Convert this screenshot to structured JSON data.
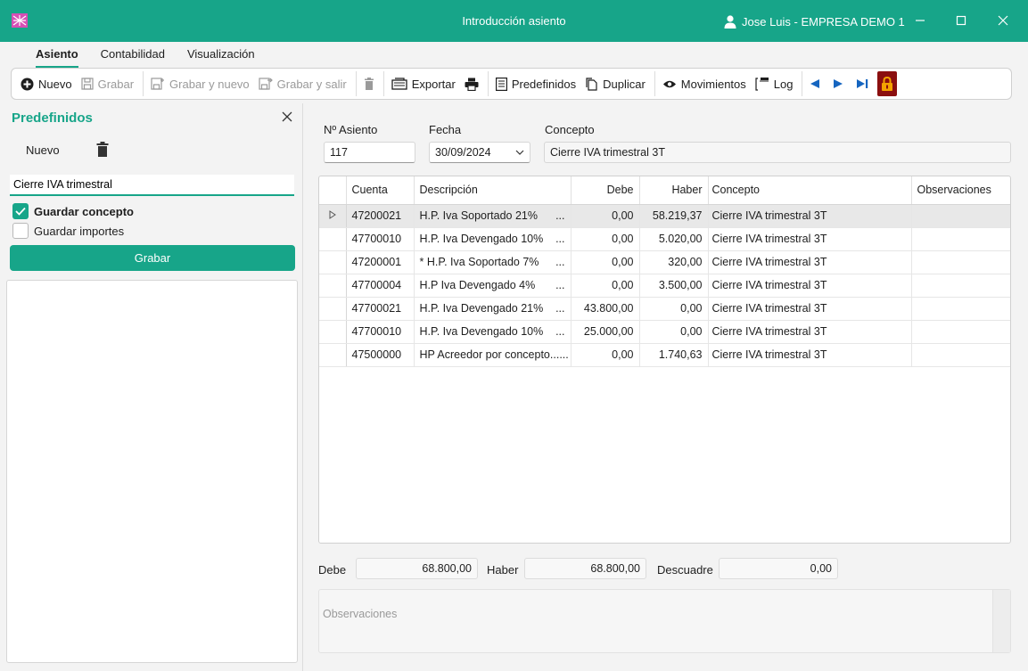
{
  "window": {
    "title": "Introducción asiento",
    "user": "Jose Luis - EMPRESA DEMO 1"
  },
  "ribbon": {
    "tabs": [
      {
        "label": "Asiento",
        "active": true
      },
      {
        "label": "Contabilidad",
        "active": false
      },
      {
        "label": "Visualización",
        "active": false
      }
    ]
  },
  "toolbar": {
    "nuevo": "Nuevo",
    "grabar": "Grabar",
    "grabar_nuevo": "Grabar y nuevo",
    "grabar_salir": "Grabar y salir",
    "exportar": "Exportar",
    "predefinidos": "Predefinidos",
    "duplicar": "Duplicar",
    "movimientos": "Movimientos",
    "log": "Log"
  },
  "left_panel": {
    "title": "Predefinidos",
    "nuevo": "Nuevo",
    "input_value": "Cierre IVA trimestral",
    "guardar_concepto": "Guardar concepto",
    "guardar_concepto_checked": true,
    "guardar_importes": "Guardar importes",
    "guardar_importes_checked": false,
    "grabar": "Grabar"
  },
  "header": {
    "asiento_label": "Nº Asiento",
    "asiento_value": "117",
    "fecha_label": "Fecha",
    "fecha_value": "30/09/2024",
    "concepto_label": "Concepto",
    "concepto_value": "Cierre IVA trimestral 3T"
  },
  "grid": {
    "columns": [
      "Cuenta",
      "Descripción",
      "Debe",
      "Haber",
      "Concepto",
      "Observaciones"
    ],
    "rows": [
      {
        "cuenta": "47200021",
        "descripcion": "H.P. Iva Soportado 21%",
        "debe": "0,00",
        "haber": "58.219,37",
        "concepto": "Cierre IVA trimestral 3T",
        "observaciones": ""
      },
      {
        "cuenta": "47700010",
        "descripcion": "H.P. Iva Devengado 10%",
        "debe": "0,00",
        "haber": "5.020,00",
        "concepto": "Cierre IVA trimestral 3T",
        "observaciones": ""
      },
      {
        "cuenta": "47200001",
        "descripcion": "* H.P. Iva Soportado 7%",
        "debe": "0,00",
        "haber": "320,00",
        "concepto": "Cierre IVA trimestral 3T",
        "observaciones": ""
      },
      {
        "cuenta": "47700004",
        "descripcion": "H.P Iva Devengado 4%",
        "debe": "0,00",
        "haber": "3.500,00",
        "concepto": "Cierre IVA trimestral 3T",
        "observaciones": ""
      },
      {
        "cuenta": "47700021",
        "descripcion": "H.P. Iva Devengado 21%",
        "debe": "43.800,00",
        "haber": "0,00",
        "concepto": "Cierre IVA trimestral 3T",
        "observaciones": ""
      },
      {
        "cuenta": "47700010",
        "descripcion": "H.P. Iva Devengado 10%",
        "debe": "25.000,00",
        "haber": "0,00",
        "concepto": "Cierre IVA trimestral 3T",
        "observaciones": ""
      },
      {
        "cuenta": "47500000",
        "descripcion": "HP Acreedor por concepto...",
        "debe": "0,00",
        "haber": "1.740,63",
        "concepto": "Cierre IVA trimestral 3T",
        "observaciones": ""
      }
    ],
    "ellipsis": "..."
  },
  "totals": {
    "debe_label": "Debe",
    "debe_value": "68.800,00",
    "haber_label": "Haber",
    "haber_value": "68.800,00",
    "descuadre_label": "Descuadre",
    "descuadre_value": "0,00"
  },
  "observaciones": {
    "placeholder": "Observaciones"
  },
  "colors": {
    "accent": "#17a589",
    "lock": "#8b0f0f"
  }
}
